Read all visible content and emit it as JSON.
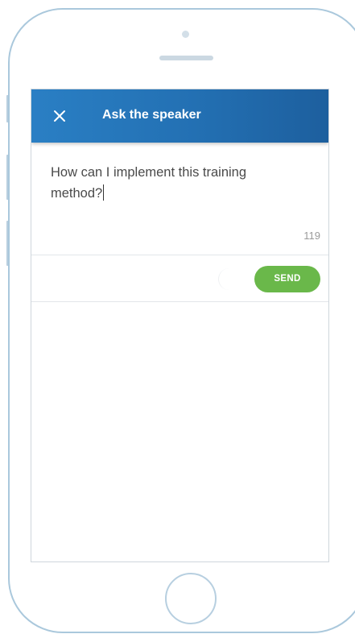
{
  "header": {
    "title": "Ask the speaker",
    "close_icon": "close-icon"
  },
  "question": {
    "text": "How can I implement this training method?",
    "remaining_characters": "119"
  },
  "actions": {
    "send_label": "SEND"
  },
  "colors": {
    "header_blue": "#2370b3",
    "send_green": "#6ab84a",
    "frame_outline": "#aac8dc"
  }
}
